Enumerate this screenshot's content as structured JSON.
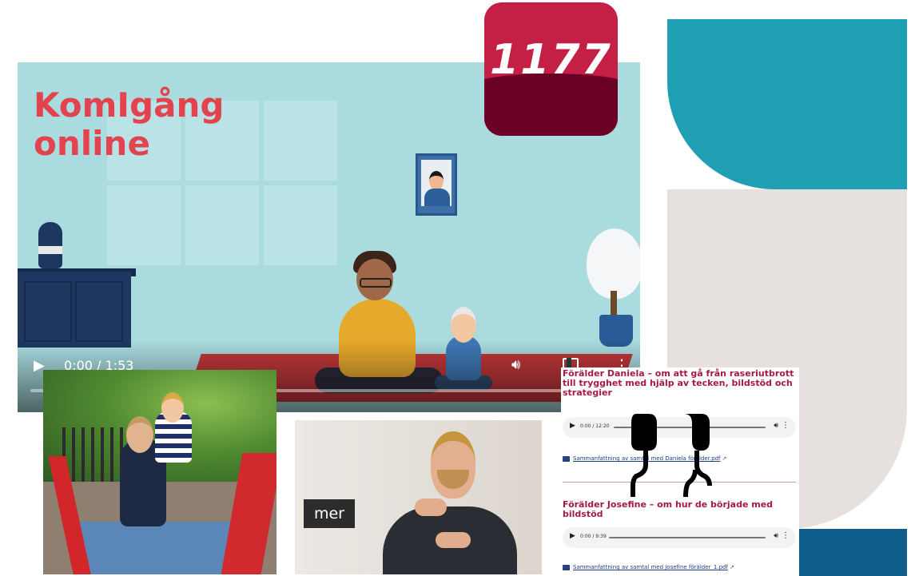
{
  "logo": {
    "text": "1177"
  },
  "video": {
    "title_line1": "KomIgång",
    "title_line2": "online",
    "time": "0:00 / 1:53"
  },
  "sign_video": {
    "label": "mer"
  },
  "audio_panel": {
    "items": [
      {
        "title": "Förälder Daniela – om att gå från raseriutbrott till trygghet med hjälp av tecken, bildstöd och strategier",
        "time": "0:00 / 12:20",
        "pdf": "Sammanfattning av samtal med Daniela förälder.pdf"
      },
      {
        "title": "Förälder Josefine – om hur de började med bildstöd",
        "time": "0:00 / 9:39",
        "pdf": "Sammanfattning av samtal med Josefine förälder_1.pdf"
      }
    ]
  },
  "icons": {
    "play": "play-icon",
    "volume": "volume-icon",
    "fullscreen": "fullscreen-icon",
    "more": "more-vertical-icon",
    "earphones": "earphones-icon",
    "document": "document-icon",
    "external_link": "external-link-icon"
  },
  "colors": {
    "brand_red": "#c41f45",
    "brand_dark": "#6b0027",
    "teal": "#1e9fb4",
    "beige": "#e6e1de",
    "navy": "#0f5d8b",
    "title_red": "#e2434f",
    "audio_title": "#a8174a"
  }
}
